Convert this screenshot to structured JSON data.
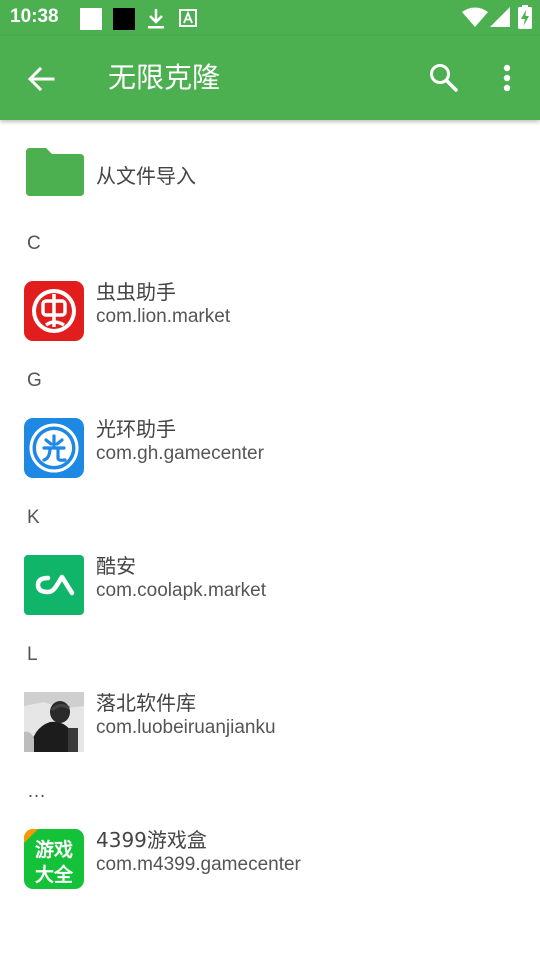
{
  "status_bar": {
    "time": "10:38",
    "icons": [
      "white-square-icon",
      "black-square-icon",
      "download-icon",
      "a-badge-icon",
      "wifi-icon",
      "signal-icon",
      "battery-charging-icon"
    ]
  },
  "app_bar": {
    "title": "无限克隆",
    "back_icon": "arrow-back-icon",
    "search_icon": "search-icon",
    "menu_icon": "more-vert-icon",
    "color": "#4caf50"
  },
  "import_row": {
    "label": "从文件导入",
    "icon": "folder-icon"
  },
  "sections": [
    {
      "header": "C",
      "apps": [
        {
          "name": "虫虫助手",
          "package": "com.lion.market",
          "icon": "chongchong-icon",
          "icon_text": "虫"
        }
      ]
    },
    {
      "header": "G",
      "apps": [
        {
          "name": "光环助手",
          "package": "com.gh.gamecenter",
          "icon": "guanghuan-icon",
          "icon_text": "光"
        }
      ]
    },
    {
      "header": "K",
      "apps": [
        {
          "name": "酷安",
          "package": "com.coolapk.market",
          "icon": "coolapk-icon"
        }
      ]
    },
    {
      "header": "L",
      "apps": [
        {
          "name": "落北软件库",
          "package": "com.luobeiruanjianku",
          "icon": "photo-avatar-icon"
        }
      ]
    },
    {
      "header": "…",
      "apps": [
        {
          "name": "4399游戏盒",
          "package": "com.m4399.gamecenter",
          "icon": "4399-icon",
          "icon_text_line1": "游戏",
          "icon_text_line2": "大全"
        }
      ]
    }
  ]
}
